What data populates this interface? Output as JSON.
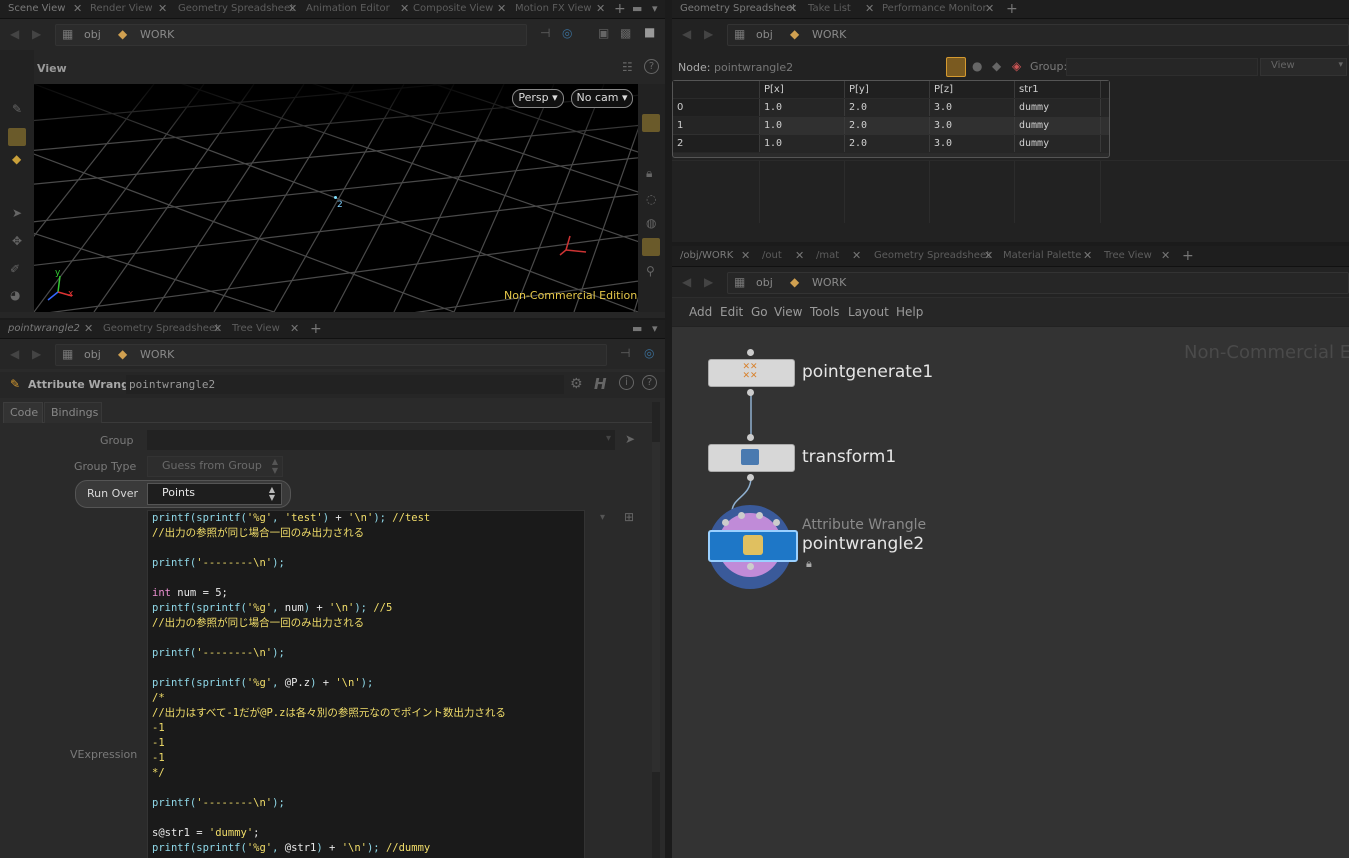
{
  "top_left_pane": {
    "tabs": [
      "Scene View",
      "Render View",
      "Geometry Spreadsheet",
      "Animation Editor",
      "Composite View",
      "Motion FX View"
    ],
    "path": [
      "obj",
      "WORK"
    ],
    "view_label": "View",
    "persp_button": "Persp",
    "cam_button": "No cam",
    "point_number": "2",
    "watermark": "Non-Commercial Edition",
    "axis_x": "x",
    "axis_y": "y"
  },
  "top_right_pane": {
    "tabs": [
      "Geometry Spreadsheet",
      "Take List",
      "Performance Monitor"
    ],
    "path": [
      "obj",
      "WORK"
    ],
    "node_label": "Node:",
    "node_value": "pointwrangle2",
    "group_label": "Group:",
    "view_button": "View",
    "columns": [
      "",
      "P[x]",
      "P[y]",
      "P[z]",
      "str1"
    ],
    "rows": [
      [
        "0",
        "1.0",
        "2.0",
        "3.0",
        "dummy"
      ],
      [
        "1",
        "1.0",
        "2.0",
        "3.0",
        "dummy"
      ],
      [
        "2",
        "1.0",
        "2.0",
        "3.0",
        "dummy"
      ]
    ]
  },
  "bottom_left_pane": {
    "tabs": [
      "pointwrangle2",
      "Geometry Spreadsheet",
      "Tree View"
    ],
    "path": [
      "obj",
      "WORK"
    ],
    "node_type": "Attribute Wrangle",
    "node_name": "pointwrangle2",
    "subtabs": [
      "Code",
      "Bindings"
    ],
    "group_label": "Group",
    "group_type_label": "Group Type",
    "group_type_value": "Guess from Group",
    "run_over_label": "Run Over",
    "run_over_value": "Points",
    "vexpression_label": "VExpression",
    "code_lines": [
      "printf(sprintf('%g', 'test') + '\\n'); //test",
      "//出力の参照が同じ場合一回のみ出力される",
      "",
      "printf('--------\\n');",
      "",
      "int num = 5;",
      "printf(sprintf('%g', num) + '\\n'); //5",
      "//出力の参照が同じ場合一回のみ出力される",
      "",
      "printf('--------\\n');",
      "",
      "printf(sprintf('%g', @P.z) + '\\n');",
      "/*",
      "//出力はすべて-1だが@P.zは各々別の参照元なのでポイント数出力される",
      "-1",
      "-1",
      "-1",
      "*/",
      "",
      "printf('--------\\n');",
      "",
      "s@str1 = 'dummy';",
      "printf(sprintf('%g', @str1) + '\\n'); //dummy"
    ]
  },
  "bottom_right_pane": {
    "tabs": [
      "/obj/WORK",
      "/out",
      "/mat",
      "Geometry Spreadsheet",
      "Material Palette",
      "Tree View"
    ],
    "path": [
      "obj",
      "WORK"
    ],
    "menu": [
      "Add",
      "Edit",
      "Go",
      "View",
      "Tools",
      "Layout",
      "Help"
    ],
    "watermark": "Non-Commercial E",
    "nodes": [
      {
        "name": "pointgenerate1"
      },
      {
        "name": "transform1"
      },
      {
        "type": "Attribute Wrangle",
        "name": "pointwrangle2"
      }
    ]
  },
  "colors": {
    "accent": "#f2a23a",
    "code_string": "#f2de6a",
    "code_function": "#8fd8e8",
    "code_keyword": "#ea8fd0",
    "wrangle_node": "#1e77c7"
  }
}
